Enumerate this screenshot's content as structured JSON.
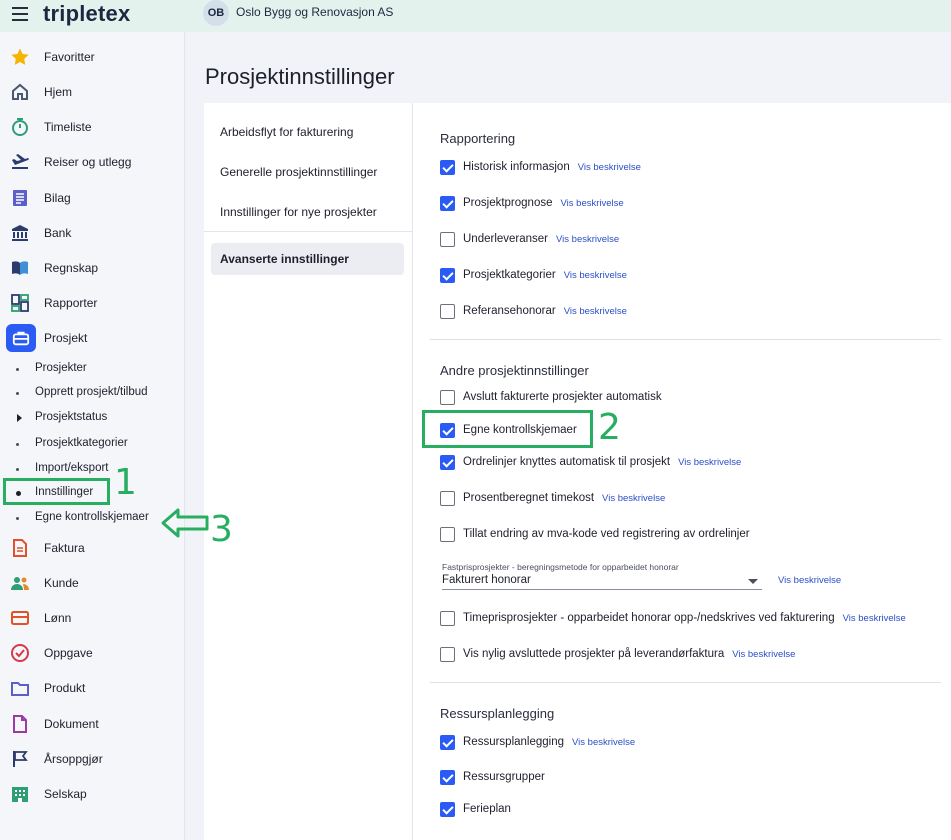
{
  "header": {
    "app_name": "tripletex",
    "company_initials": "OB",
    "company_name": "Oslo Bygg og Renovasjon AS"
  },
  "sidebar": {
    "top_items": [
      {
        "label": "Favoritter",
        "icon": "star-icon"
      },
      {
        "label": "Hjem",
        "icon": "home-icon"
      },
      {
        "label": "Timeliste",
        "icon": "stopwatch-icon"
      },
      {
        "label": "Reiser og utlegg",
        "icon": "plane-icon"
      },
      {
        "label": "Bilag",
        "icon": "document-list-icon"
      },
      {
        "label": "Bank",
        "icon": "bank-icon"
      },
      {
        "label": "Regnskap",
        "icon": "book-icon"
      },
      {
        "label": "Rapporter",
        "icon": "dashboard-icon"
      },
      {
        "label": "Prosjekt",
        "icon": "briefcase-icon"
      }
    ],
    "project_sub_items": [
      {
        "label": "Prosjekter"
      },
      {
        "label": "Opprett prosjekt/tilbud"
      },
      {
        "label": "Prosjektstatus"
      },
      {
        "label": "Prosjektkategorier"
      },
      {
        "label": "Import/eksport"
      },
      {
        "label": "Innstillinger"
      },
      {
        "label": "Egne kontrollskjemaer"
      }
    ],
    "bottom_items": [
      {
        "label": "Faktura",
        "icon": "invoice-icon"
      },
      {
        "label": "Kunde",
        "icon": "people-icon"
      },
      {
        "label": "Lønn",
        "icon": "wallet-icon"
      },
      {
        "label": "Oppgave",
        "icon": "check-circle-icon"
      },
      {
        "label": "Produkt",
        "icon": "folder-icon"
      },
      {
        "label": "Dokument",
        "icon": "file-icon"
      },
      {
        "label": "Årsoppgjør",
        "icon": "flag-icon"
      },
      {
        "label": "Selskap",
        "icon": "building-icon"
      }
    ],
    "colors": {
      "accent": "#2a5cf5"
    }
  },
  "page": {
    "title": "Prosjektinnstillinger"
  },
  "subnav": {
    "items": [
      {
        "label": "Arbeidsflyt for fakturering"
      },
      {
        "label": "Generelle prosjektinnstillinger"
      },
      {
        "label": "Innstillinger for nye prosjekter"
      },
      {
        "label": "Avanserte innstillinger"
      }
    ]
  },
  "settings": {
    "rapportering": {
      "title": "Rapportering",
      "items": [
        {
          "label": "Historisk informasjon",
          "checked": true,
          "link": "Vis beskrivelse"
        },
        {
          "label": "Prosjektprognose",
          "checked": true,
          "link": "Vis beskrivelse"
        },
        {
          "label": "Underleveranser",
          "checked": false,
          "link": "Vis beskrivelse"
        },
        {
          "label": "Prosjektkategorier",
          "checked": true,
          "link": "Vis beskrivelse"
        },
        {
          "label": "Referansehonorar",
          "checked": false,
          "link": "Vis beskrivelse"
        }
      ]
    },
    "andre": {
      "title": "Andre prosjektinnstillinger",
      "items": [
        {
          "label": "Avslutt fakturerte prosjekter automatisk",
          "checked": false,
          "link": ""
        },
        {
          "label": "Egne kontrollskjemaer",
          "checked": true,
          "link": ""
        },
        {
          "label": "Ordrelinjer knyttes automatisk til prosjekt",
          "checked": true,
          "link": "Vis beskrivelse"
        },
        {
          "label": "Prosentberegnet timekost",
          "checked": false,
          "link": "Vis beskrivelse"
        },
        {
          "label": "Tillat endring av mva-kode ved registrering av ordrelinjer",
          "checked": false,
          "link": ""
        }
      ],
      "fastpris": {
        "caption": "Fastprisprosjekter - beregningsmetode for opparbeidet honorar",
        "value": "Fakturert honorar",
        "link": "Vis beskrivelse"
      },
      "items_after": [
        {
          "label": "Timeprisprosjekter - opparbeidet honorar opp-/nedskrives ved fakturering",
          "checked": false,
          "link": "Vis beskrivelse"
        },
        {
          "label": "Vis nylig avsluttede prosjekter på leverandørfaktura",
          "checked": false,
          "link": "Vis beskrivelse"
        }
      ]
    },
    "ressurs": {
      "title": "Ressursplanlegging",
      "items": [
        {
          "label": "Ressursplanlegging",
          "checked": true,
          "link": "Vis beskrivelse"
        },
        {
          "label": "Ressursgrupper",
          "checked": true,
          "link": ""
        },
        {
          "label": "Ferieplan",
          "checked": true,
          "link": ""
        }
      ]
    }
  },
  "annotations": {
    "color": "#27ae60",
    "labels": [
      "1",
      "2",
      "3"
    ]
  }
}
